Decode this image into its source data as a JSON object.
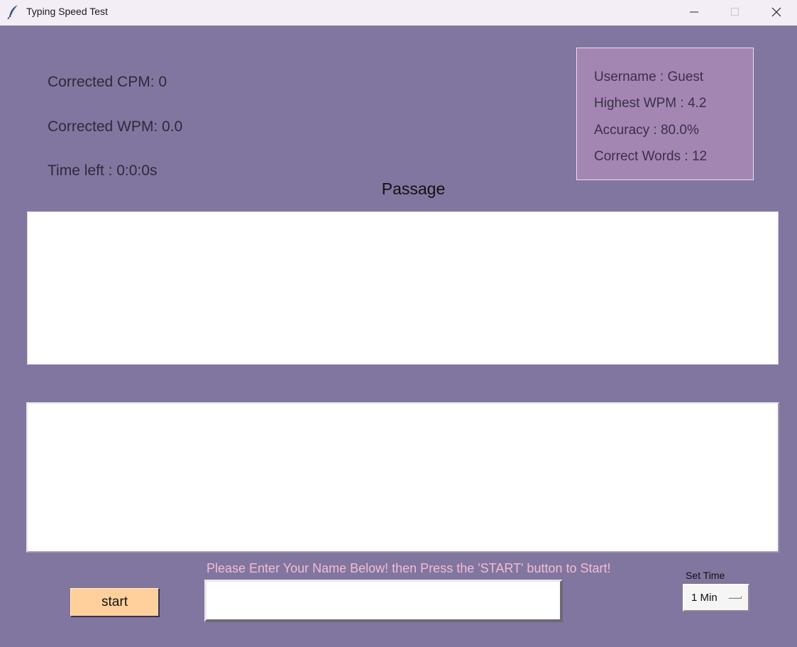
{
  "window": {
    "title": "Typing Speed Test",
    "icon": "feather-icon",
    "controls": [
      "minimize-icon",
      "maximize-icon",
      "close-icon"
    ]
  },
  "stats": {
    "cpm": "Corrected CPM: 0",
    "wpm": "Corrected WPM: 0.0",
    "time_left": "Time left : 0:0:0s"
  },
  "profile": {
    "username": "Username : Guest",
    "highest_wpm": "Highest WPM : 4.2",
    "accuracy": "Accuracy : 80.0%",
    "correct_words": "Correct Words : 12"
  },
  "passage": {
    "title": "Passage",
    "text": ""
  },
  "typing_area": {
    "value": ""
  },
  "name_entry": {
    "instruction": "Please Enter Your Name Below! then Press the 'START' button to Start!",
    "value": ""
  },
  "controls": {
    "start_label": "start",
    "set_time_label": "Set Time",
    "time_selected": "1 Min"
  },
  "colors": {
    "background": "#8176a0",
    "profile_box": "#a486b2",
    "start_button": "#ffd09b",
    "instruction_text": "#f3bcd2"
  }
}
